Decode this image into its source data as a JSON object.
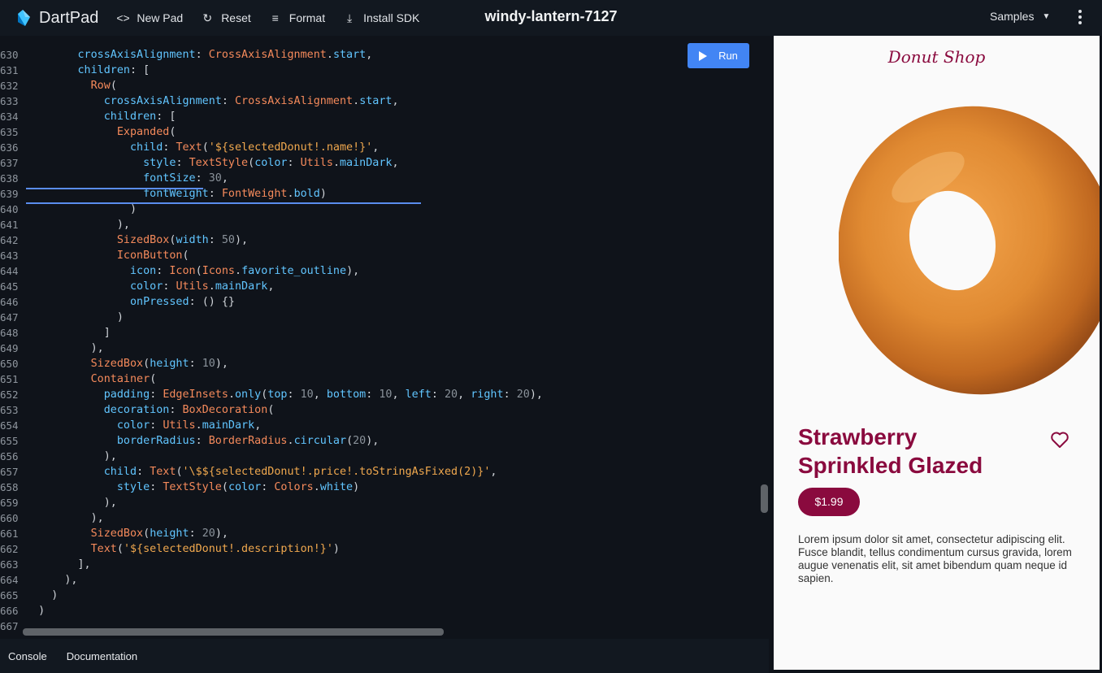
{
  "app": {
    "name": "DartPad",
    "pad_title": "windy-lantern-7127",
    "toolbar": {
      "new_pad": "New Pad",
      "reset": "Reset",
      "format": "Format",
      "install_sdk": "Install SDK",
      "samples": "Samples"
    }
  },
  "editor": {
    "run_label": "Run",
    "lines": [
      {
        "n": "630",
        "text": "        crossAxisAlignment: CrossAxisAlignment.start,"
      },
      {
        "n": "631",
        "text": "        children: ["
      },
      {
        "n": "632",
        "text": "          Row("
      },
      {
        "n": "633",
        "text": "            crossAxisAlignment: CrossAxisAlignment.start,"
      },
      {
        "n": "634",
        "text": "            children: ["
      },
      {
        "n": "635",
        "text": "              Expanded("
      },
      {
        "n": "636",
        "text": "                child: Text('${selectedDonut!.name!}',"
      },
      {
        "n": "637",
        "text": "                  style: TextStyle(color: Utils.mainDark,"
      },
      {
        "n": "638",
        "text": "                  fontSize: 30,"
      },
      {
        "n": "639",
        "text": "                  fontWeight: FontWeight.bold)"
      },
      {
        "n": "640",
        "text": "                )"
      },
      {
        "n": "641",
        "text": "              ),"
      },
      {
        "n": "642",
        "text": "              SizedBox(width: 50),"
      },
      {
        "n": "643",
        "text": "              IconButton("
      },
      {
        "n": "644",
        "text": "                icon: Icon(Icons.favorite_outline),"
      },
      {
        "n": "645",
        "text": "                color: Utils.mainDark,"
      },
      {
        "n": "646",
        "text": "                onPressed: () {}"
      },
      {
        "n": "647",
        "text": "              )"
      },
      {
        "n": "648",
        "text": "            ]"
      },
      {
        "n": "649",
        "text": "          ),"
      },
      {
        "n": "650",
        "text": "          SizedBox(height: 10),"
      },
      {
        "n": "651",
        "text": "          Container("
      },
      {
        "n": "652",
        "text": "            padding: EdgeInsets.only(top: 10, bottom: 10, left: 20, right: 20),"
      },
      {
        "n": "653",
        "text": "            decoration: BoxDecoration("
      },
      {
        "n": "654",
        "text": "              color: Utils.mainDark,"
      },
      {
        "n": "655",
        "text": "              borderRadius: BorderRadius.circular(20),"
      },
      {
        "n": "656",
        "text": "            ),"
      },
      {
        "n": "657",
        "text": "            child: Text('\\$${selectedDonut!.price!.toStringAsFixed(2)}',"
      },
      {
        "n": "658",
        "text": "              style: TextStyle(color: Colors.white)"
      },
      {
        "n": "659",
        "text": "            ),"
      },
      {
        "n": "660",
        "text": "          ),"
      },
      {
        "n": "661",
        "text": "          SizedBox(height: 20),"
      },
      {
        "n": "662",
        "text": "          Text('${selectedDonut!.description!}')"
      },
      {
        "n": "663",
        "text": "        ],"
      },
      {
        "n": "664",
        "text": "      ),"
      },
      {
        "n": "665",
        "text": "    )"
      },
      {
        "n": "666",
        "text": "  )"
      },
      {
        "n": "667",
        "text": ""
      }
    ]
  },
  "bottom_tabs": {
    "console": "Console",
    "documentation": "Documentation"
  },
  "preview": {
    "shop_title": "Donut Shop",
    "donut_name": "Strawberry Sprinkled Glazed",
    "price": "$1.99",
    "description": "Lorem ipsum dolor sit amet, consectetur adipiscing elit. Fusce blandit, tellus condimentum cursus gravida, lorem augue venenatis elit, sit amet bibendum quam neque id sapien.",
    "brand_color": "#8a0a3e"
  },
  "colors": {
    "topbar": "#121820",
    "editor_bg": "#0f131a",
    "run_button": "#4285f4"
  }
}
